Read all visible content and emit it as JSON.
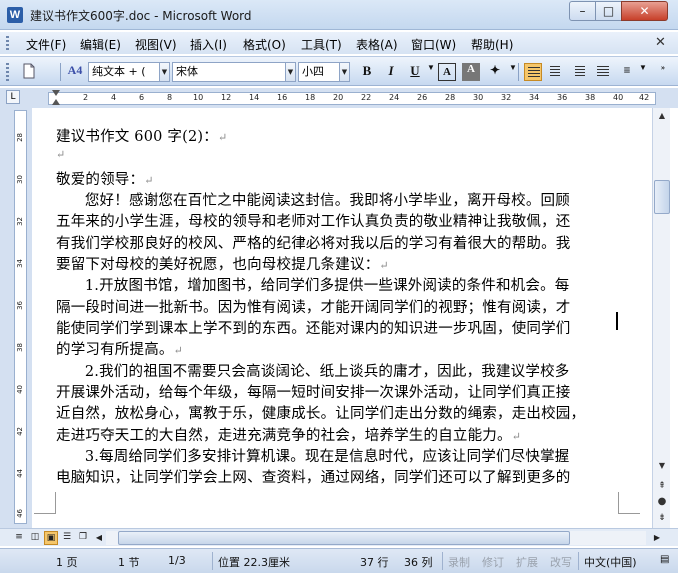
{
  "window": {
    "title": "建议书作文600字.doc - Microsoft Word",
    "app_icon": "W",
    "minimize": "–",
    "maximize": "□",
    "close": "✕"
  },
  "menu": {
    "items": [
      "文件(F)",
      "编辑(E)",
      "视图(V)",
      "插入(I)",
      "格式(O)",
      "工具(T)",
      "表格(A)",
      "窗口(W)",
      "帮助(H)"
    ],
    "close_doc": "✕"
  },
  "toolbar": {
    "style_value": "纯文本 + (",
    "font_value": "宋体",
    "size_value": "小四",
    "bold": "B",
    "italic": "I",
    "underline": "U",
    "char_border": "A",
    "char_shading": "A"
  },
  "ruler": {
    "tab_selector": "L",
    "numbers": [
      "2",
      "4",
      "6",
      "8",
      "10",
      "12",
      "14",
      "16",
      "18",
      "20",
      "22",
      "24",
      "26",
      "28",
      "30",
      "32",
      "34",
      "36",
      "38",
      "40",
      "42"
    ]
  },
  "vruler": {
    "numbers": [
      "28",
      "30",
      "32",
      "34",
      "36",
      "38",
      "40",
      "42",
      "44",
      "46"
    ]
  },
  "document": {
    "lines": [
      "建议书作文 600 字(2)：",
      "",
      "敬爱的领导：",
      "      您好！感谢您在百忙之中能阅读这封信。我即将小学毕业，离开母校。回顾",
      "五年来的小学生涯，母校的领导和老师对工作认真负责的敬业精神让我敬佩，还",
      "有我们学校那良好的校风、严格的纪律必将对我以后的学习有着很大的帮助。我",
      "要留下对母校的美好祝愿，也向母校提几条建议：",
      "      1.开放图书馆，增加图书，给同学们多提供一些课外阅读的条件和机会。每",
      "隔一段时间进一批新书。因为惟有阅读，才能开阔同学们的视野；惟有阅读，才",
      "能使同学们学到课本上学不到的东西。还能对课内的知识进一步巩固，使同学们",
      "的学习有所提高。",
      "      2.我们的祖国不需要只会高谈阔论、纸上谈兵的庸才，因此，我建议学校多",
      "开展课外活动，给每个年级，每隔一短时间安排一次课外活动，让同学们真正接",
      "近自然，放松身心，寓教于乐，健康成长。让同学们走出分数的绳索，走出校园，",
      "走进巧夺天工的大自然，走进充满竞争的社会，培养学生的自立能力。",
      "      3.每周给同学们多安排计算机课。现在是信息时代，应该让同学们尽快掌握",
      "电脑知识，让同学们学会上网、查资料，通过网络，同学们还可以了解到更多的"
    ],
    "para_marks": [
      true,
      true,
      true,
      false,
      false,
      false,
      true,
      false,
      false,
      false,
      true,
      false,
      false,
      false,
      true,
      false,
      false
    ]
  },
  "status": {
    "page": "1 页",
    "section": "1 节",
    "page_of": "1/3",
    "position": "位置 22.3厘米",
    "line": "37 行",
    "column": "36 列",
    "rec": "录制",
    "trk": "修订",
    "ext": "扩展",
    "ovr": "改写",
    "language": "中文(中国)"
  }
}
